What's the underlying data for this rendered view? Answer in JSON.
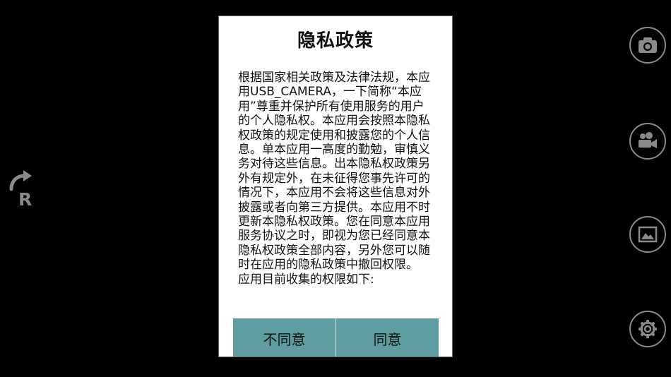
{
  "dialog": {
    "title": "隐私政策",
    "body": "根据国家相关政策及法律法规，本应用USB_CAMERA，一下简称“本应用”尊重并保护所有使用服务的用户的个人隐私权。本应用会按照本隐私权政策的规定使用和披露您的个人信息。单本应用一高度的勤勉，审慎义务对待这些信息。出本隐私权政策另外有规定外，在未征得您事先许可的情况下，本应用不会将这些信息对外披露或者向第三方提供。本应用不时更新本隐私权政策。您在同意本应用服务协议之时，即视为您已经同意本隐私权政策全部内容，另外您可以随时在应用的隐私政策中撤回权限。\n应用目前收集的权限如下:",
    "disagree_label": "不同意",
    "agree_label": "同意"
  },
  "left_controls": {
    "rotate_letter": "R"
  },
  "right_controls": {
    "icons": [
      "camera-icon",
      "video-camera-icon",
      "gallery-icon",
      "settings-icon"
    ]
  },
  "colors": {
    "button_bg": "#5f9ea0",
    "background": "#000000",
    "icon_gray": "#8a8a8a"
  }
}
